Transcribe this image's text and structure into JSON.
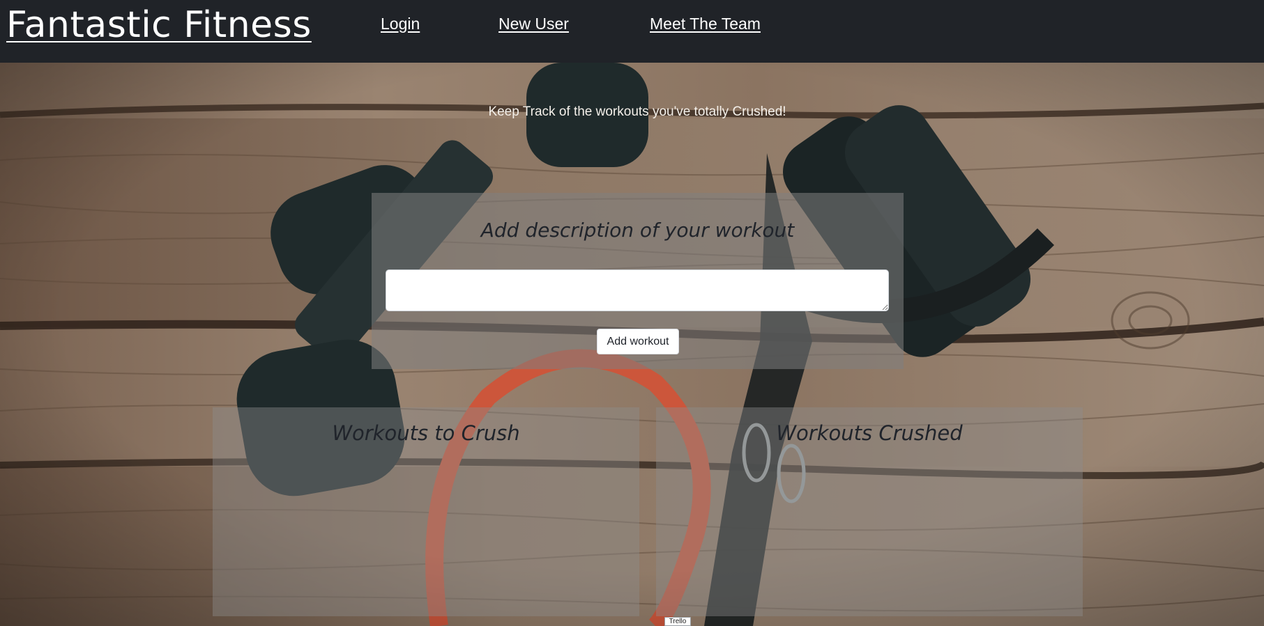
{
  "nav": {
    "brand": "Fantastic Fitness",
    "links": [
      {
        "label": "Login"
      },
      {
        "label": "New User"
      },
      {
        "label": "Meet The Team"
      }
    ]
  },
  "tagline": "Keep Track of the workouts you've totally Crushed!",
  "add_panel": {
    "title": "Add description of your workout",
    "input_value": "",
    "button_label": "Add workout"
  },
  "lists": {
    "to_crush": {
      "title": "Workouts to Crush",
      "items": []
    },
    "crushed": {
      "title": "Workouts Crushed",
      "items": []
    }
  },
  "badge": "Trello",
  "colors": {
    "navbar": "#202328",
    "panel_overlay": "rgba(128,128,128,0.55)",
    "text_dark": "#20242b",
    "wood": "#8a735f",
    "dumbbell": "#1f2a2b",
    "band": "#d2593d"
  }
}
